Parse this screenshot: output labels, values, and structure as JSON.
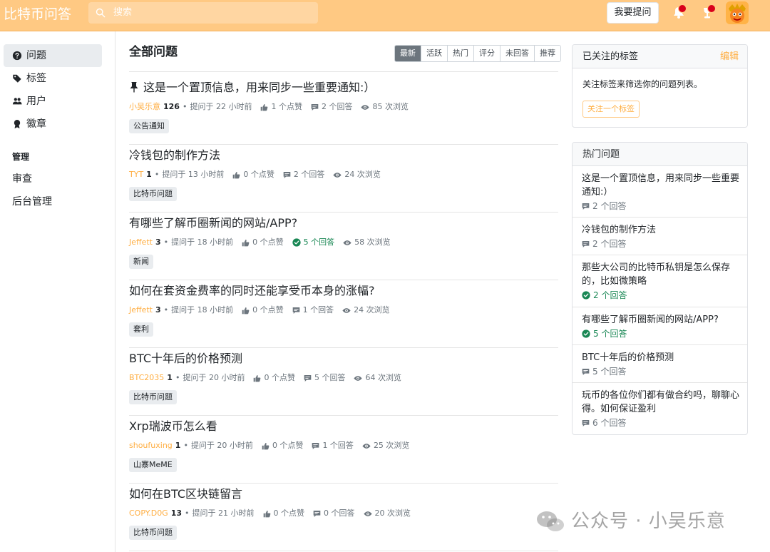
{
  "header": {
    "brand": "比特币问答",
    "search_placeholder": "搜索",
    "ask_button": "我要提问",
    "colors": {
      "bar": "#ffc983",
      "accent": "#ffae42",
      "badge": "#d9001b"
    }
  },
  "sidebar": {
    "items": [
      {
        "label": "问题",
        "icon": "question-circle-icon",
        "active": true
      },
      {
        "label": "标签",
        "icon": "tag-icon",
        "active": false
      },
      {
        "label": "用户",
        "icon": "users-icon",
        "active": false
      },
      {
        "label": "徽章",
        "icon": "award-icon",
        "active": false
      }
    ],
    "admin_heading": "管理",
    "admin_links": [
      "审查",
      "后台管理"
    ]
  },
  "main": {
    "title": "全部问题",
    "filters": [
      "最新",
      "活跃",
      "热门",
      "评分",
      "未回答",
      "推荐"
    ],
    "active_filter": "最新",
    "questions": [
      {
        "pinned": true,
        "title": "这是一个置顶信息，用来同步一些重要通知:）",
        "author": "小吴乐意",
        "rep": "126",
        "asked": "提问于 22 小时前",
        "votes": "1 个点赞",
        "answers": "2 个回答",
        "answered": false,
        "views": "85 次浏览",
        "tag": "公告通知"
      },
      {
        "pinned": false,
        "title": "冷钱包的制作方法",
        "author": "TYT",
        "rep": "1",
        "asked": "提问于 13 小时前",
        "votes": "0 个点赞",
        "answers": "2 个回答",
        "answered": false,
        "views": "24 次浏览",
        "tag": "比特币问题"
      },
      {
        "pinned": false,
        "title": "有哪些了解币圈新闻的网站/APP?",
        "author": "Jeffett",
        "rep": "3",
        "asked": "提问于 18 小时前",
        "votes": "0 个点赞",
        "answers": "5 个回答",
        "answered": true,
        "views": "58 次浏览",
        "tag": "新闻"
      },
      {
        "pinned": false,
        "title": "如何在套资金费率的同时还能享受币本身的涨幅?",
        "author": "Jeffett",
        "rep": "3",
        "asked": "提问于 18 小时前",
        "votes": "0 个点赞",
        "answers": "1 个回答",
        "answered": false,
        "views": "24 次浏览",
        "tag": "套利"
      },
      {
        "pinned": false,
        "title": "BTC十年后的价格预测",
        "author": "BTC2035",
        "rep": "1",
        "asked": "提问于 20 小时前",
        "votes": "0 个点赞",
        "answers": "5 个回答",
        "answered": false,
        "views": "64 次浏览",
        "tag": "比特币问题"
      },
      {
        "pinned": false,
        "title": "Xrp瑞波币怎么看",
        "author": "shoufuxing",
        "rep": "1",
        "asked": "提问于 20 小时前",
        "votes": "0 个点赞",
        "answers": "1 个回答",
        "answered": false,
        "views": "25 次浏览",
        "tag": "山寨MeME"
      },
      {
        "pinned": false,
        "title": "如何在BTC区块链留言",
        "author": "COPY.D0G",
        "rep": "13",
        "asked": "提问于 21 小时前",
        "votes": "0 个点赞",
        "answers": "0 个回答",
        "answered": false,
        "views": "20 次浏览",
        "tag": "比特币问题"
      }
    ]
  },
  "right": {
    "watched": {
      "title": "已关注的标签",
      "edit": "编辑",
      "text": "关注标签来筛选你的问题列表。",
      "button": "关注一个标签"
    },
    "hot": {
      "title": "热门问题",
      "items": [
        {
          "title": "这是一个置顶信息，用来同步一些重要通知:）",
          "answers": "2 个回答",
          "answered": false
        },
        {
          "title": "冷钱包的制作方法",
          "answers": "2 个回答",
          "answered": false
        },
        {
          "title": "那些大公司的比特币私钥是怎么保存的，比如微策略",
          "answers": "2 个回答",
          "answered": true
        },
        {
          "title": "有哪些了解币圈新闻的网站/APP?",
          "answers": "5 个回答",
          "answered": true
        },
        {
          "title": "BTC十年后的价格预测",
          "answers": "5 个回答",
          "answered": false
        },
        {
          "title": "玩币的各位你们都有做合约吗，聊聊心得。如何保证盈利",
          "answers": "6 个回答",
          "answered": false
        }
      ]
    }
  },
  "watermark": "公众号 · 小吴乐意"
}
